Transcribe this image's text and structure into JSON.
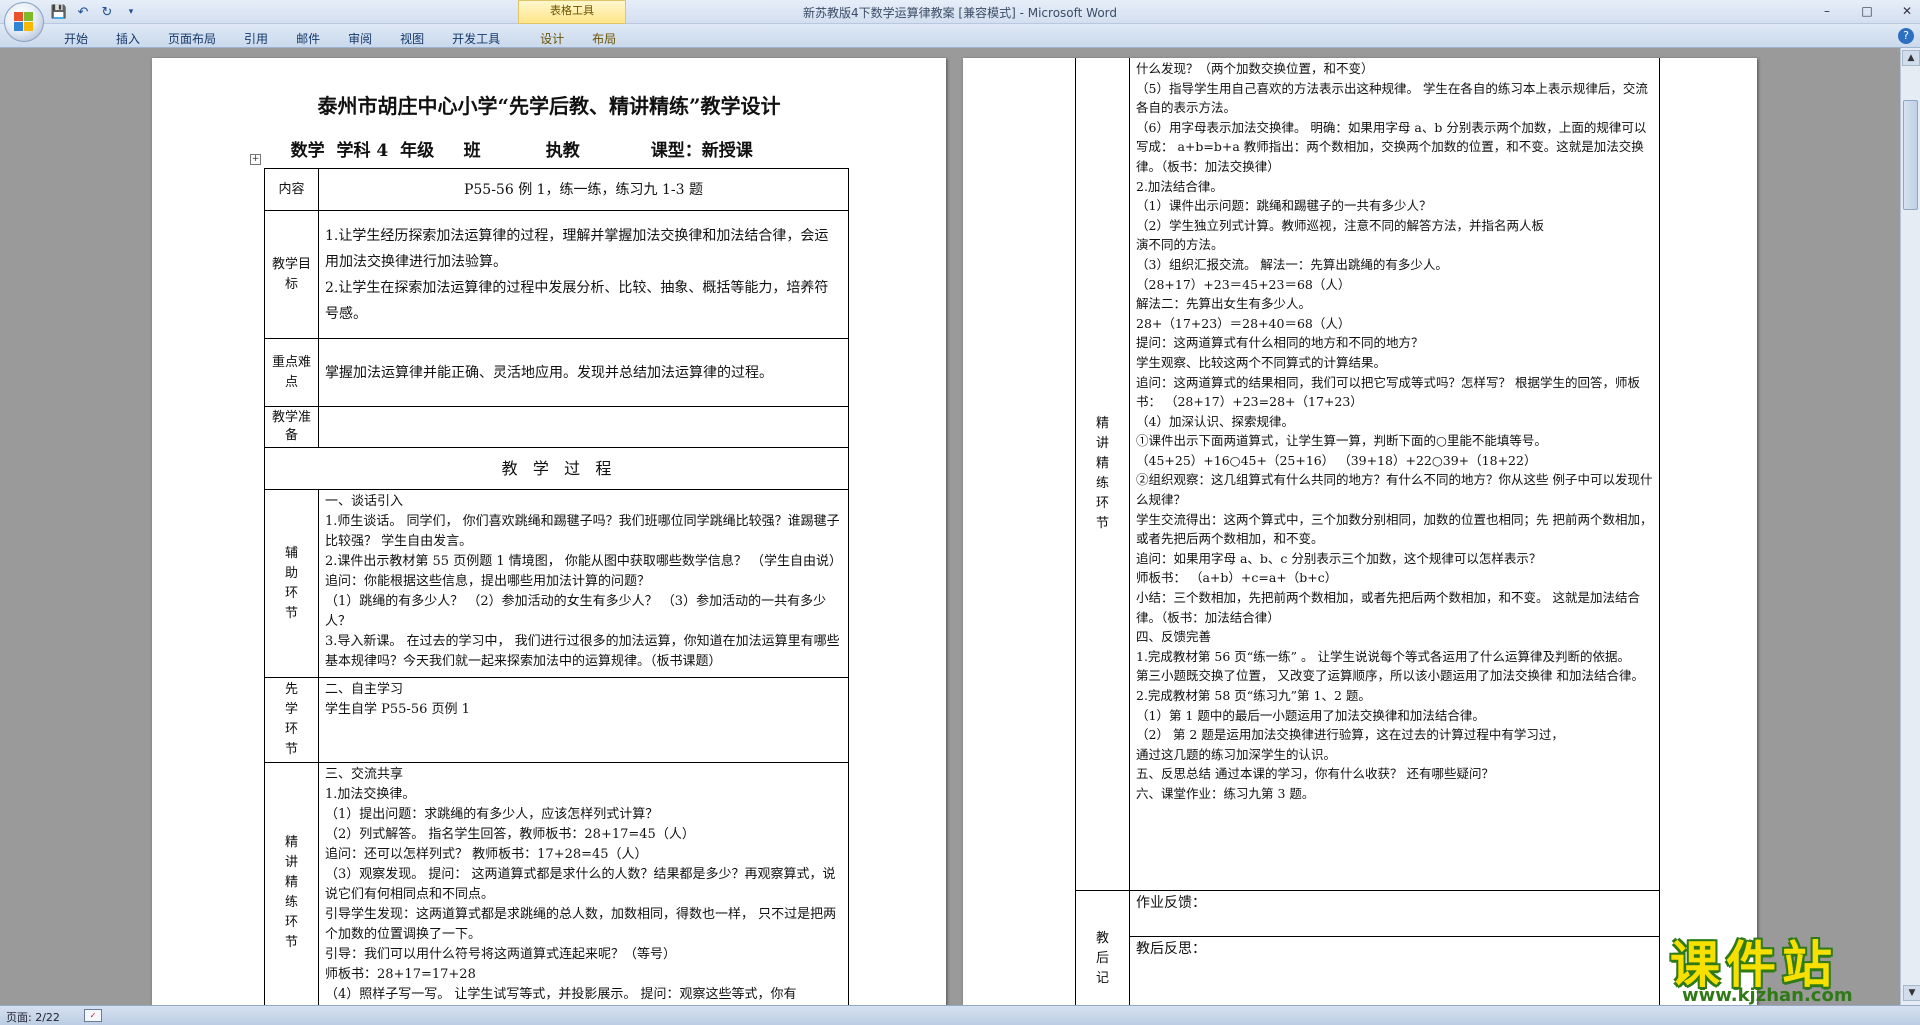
{
  "window": {
    "title": "新苏教版4下数学运算律教案 [兼容模式] - Microsoft Word",
    "context_tab_group": "表格工具"
  },
  "ribbon": {
    "tabs": [
      "开始",
      "插入",
      "页面布局",
      "引用",
      "邮件",
      "审阅",
      "视图",
      "开发工具",
      "设计",
      "布局"
    ]
  },
  "status": {
    "page": "页面: 2/22"
  },
  "watermark": {
    "main": "课件站",
    "sub": "www.kjzhan.com"
  },
  "icons": {
    "office": "office-button-icon",
    "save": "save-icon",
    "undo": "undo-icon",
    "redo": "redo-icon"
  },
  "colors": {
    "accent": "#2f6fc2",
    "watermark_yellow": "#f7e000",
    "watermark_green": "#2f7a16"
  },
  "doc": {
    "title": "泰州市胡庄中心小学“先学后教、精讲精练”教学设计",
    "subtitle": "    数学  学科 4  年级     班           执教            课型：新授课",
    "left_table": {
      "content_label": "内容",
      "content_value": "P55-56 例 1，练一练，练习九 1-3 题",
      "goal_label": "教学目标",
      "goals": [
        "1.让学生经历探索加法运算律的过程，理解并掌握加法交换律和加法结合律，会运用加法交换律进行加法验算。",
        "2.让学生在探索加法运算律的过程中发展分析、比较、抽象、概括等能力，培养符号感。"
      ],
      "key_label": "重点难点",
      "key_value": "掌握加法运算律并能正确、灵活地应用。发现并总结加法运算律的过程。",
      "prep_label": "教学准备",
      "process_title": "教   学   过   程",
      "aux_label": "辅助环节",
      "aux_lines": [
        "一、谈话引入",
        "1.师生谈话。 同学们， 你们喜欢跳绳和踢毽子吗？我们班哪位同学跳绳比较强？谁踢毽子 比较强？ 学生自由发言。",
        "2.课件出示教材第 55 页例题 1 情境图， 你能从图中获取哪些数学信息？ （学生自由说） 追问：你能根据这些信息，提出哪些用加法计算的问题？",
        "（1）跳绳的有多少人？ （2）参加活动的女生有多少人？ （3）参加活动的一共有多少人？",
        "3.导入新课。 在过去的学习中， 我们进行过很多的加法运算，你知道在加法运算里有哪些 基本规律吗？今天我们就一起来探索加法中的运算规律。（板书课题）"
      ],
      "pre_label": "先学环节",
      "pre_lines": [
        "二、自主学习",
        "学生自学 P55-56 页例 1"
      ],
      "main_label": "精讲精练环节",
      "main_lines": [
        "三、交流共享",
        "1.加法交换律。",
        "（1）提出问题：求跳绳的有多少人，应该怎样列式计算？",
        "（2）列式解答。 指名学生回答，教师板书：28+17=45（人）",
        "追问：还可以怎样列式？ 教师板书：17+28=45（人）",
        "（3）观察发现。 提问： 这两道算式都是求什么的人数？结果都是多少？再观察算式，说说它们有何相同点和不同点。",
        "引导学生发现：这两道算式都是求跳绳的总人数，加数相同，得数也一样， 只不过是把两个加数的位置调换了一下。",
        "引导：我们可以用什么符号将这两道算式连起来呢？（等号）",
        "师板书：28+17=17+28",
        "（4）照样子写一写。 让学生试写等式，并投影展示。 提问：观察这些等式，你有"
      ]
    },
    "right_table": {
      "main_label": "精讲精练环节",
      "main_lines": [
        "什么发现？（两个加数交换位置，和不变）",
        "（5）指导学生用自己喜欢的方法表示出这种规律。 学生在各自的练习本上表示规律后，交流各自的表示方法。",
        "（6）用字母表示加法交换律。 明确：如果用字母 a、b 分别表示两个加数，上面的规律可以写成： a+b=b+a 教师指出：两个数相加，交换两个加数的位置，和不变。这就是加法交换律。（板书：加法交换律）",
        "2.加法结合律。",
        "（1）课件出示问题：跳绳和踢毽子的一共有多少人？",
        "（2）学生独立列式计算。教师巡视，注意不同的解答方法，并指名两人板",
        "演不同的方法。",
        "（3）组织汇报交流。 解法一：先算出跳绳的有多少人。",
        "（28+17）+23＝45+23＝68（人）",
        "解法二：先算出女生有多少人。",
        "28+（17+23）＝28+40＝68（人）",
        "提问：这两道算式有什么相同的地方和不同的地方？",
        "学生观察、比较这两个不同算式的计算结果。",
        "追问：这两道算式的结果相同，我们可以把它写成等式吗？怎样写？ 根据学生的回答，师板书： （28+17）+23=28+（17+23）",
        "（4）加深认识、探索规律。",
        "①课件出示下面两道算式，让学生算一算，判断下面的○里能不能填等号。 （45+25）+16○45+（25+16） （39+18）+22○39+（18+22）",
        "②组织观察：这几组算式有什么共同的地方？有什么不同的地方？你从这些 例子中可以发现什么规律？",
        "学生交流得出：这两个算式中，三个加数分别相同，加数的位置也相同；先 把前两个数相加，或者先把后两个数相加，和不变。",
        "追问：如果用字母 a、b、c 分别表示三个加数，这个规律可以怎样表示？",
        "师板书： （a+b）+c=a+（b+c）",
        "小结：三个数相加，先把前两个数相加，或者先把后两个数相加，和不变。 这就是加法结合律。（板书：加法结合律）",
        " 四、反馈完善",
        "1.完成教材第 56 页“练一练” 。 让学生说说每个等式各运用了什么运算律及判断的依据。",
        "第三小题既交换了位置， 又改变了运算顺序，所以该小题运用了加法交换律 和加法结合律。",
        "2.完成教材第 58 页“练习九”第 1、2 题。",
        "（1）第 1 题中的最后一小题运用了加法交换律和加法结合律。",
        "（2） 第 2 题是运用加法交换律进行验算，这在过去的计算过程中有学习过，",
        "通过这几题的练习加深学生的认识。",
        "五、反思总结 通过本课的学习，你有什么收获？ 还有哪些疑问？",
        "六、课堂作业：练习九第 3 题。"
      ],
      "after_label": "教后记",
      "feedback": "作业反馈：",
      "reflection": "教后反思："
    }
  }
}
